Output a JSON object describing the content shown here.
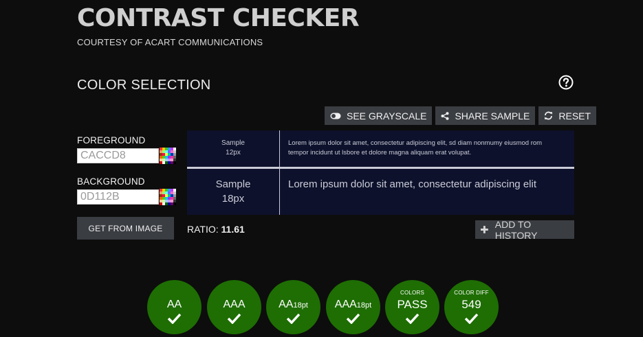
{
  "header": {
    "title": "CONTRAST CHECKER",
    "subtitle": "COURTESY OF ACART COMMUNICATIONS"
  },
  "section": {
    "title": "COLOR SELECTION",
    "help_icon": "question-circle-icon"
  },
  "toolbar": {
    "grayscale_label": "SEE GRAYSCALE",
    "share_label": "SHARE SAMPLE",
    "reset_label": "RESET"
  },
  "inputs": {
    "foreground_label": "FOREGROUND",
    "foreground_value": "CACCD8",
    "background_label": "BACKGROUND",
    "background_value": "0D112B",
    "get_image_label": "GET FROM IMAGE"
  },
  "sample": {
    "small_label_line1": "Sample",
    "small_label_line2": "12px",
    "small_text": "Lorem ipsum dolor sit amet, consectetur adipiscing elit, sd diam nonmumy eiusmod rom tempor incidunt ut lsbore et dolore magna aliquam erat volupat.",
    "large_label_line1": "Sample",
    "large_label_line2": "18px",
    "large_text": "Lorem ipsum dolor sit amet, consectetur adipiscing elit"
  },
  "ratio": {
    "label": "RATIO:",
    "value": "11.61"
  },
  "history": {
    "label": "ADD TO HISTORY"
  },
  "results": [
    {
      "main": "AA",
      "suffix": "",
      "caption": "",
      "status": "pass"
    },
    {
      "main": "AAA",
      "suffix": "",
      "caption": "",
      "status": "pass"
    },
    {
      "main": "AA",
      "suffix": "18pt",
      "caption": "",
      "status": "pass"
    },
    {
      "main": "AAA",
      "suffix": "18pt",
      "caption": "",
      "status": "pass"
    },
    {
      "main": "PASS",
      "suffix": "",
      "caption": "COLORS",
      "status": "pass"
    },
    {
      "main": "549",
      "suffix": "",
      "caption": "COLOR DIFF",
      "status": "pass"
    }
  ],
  "colors": {
    "background": "#0d0d0d",
    "button": "#3a3d42",
    "sample_fg": "#caccd8",
    "sample_bg": "#0d112b",
    "pass_green": "#1e6e03"
  }
}
